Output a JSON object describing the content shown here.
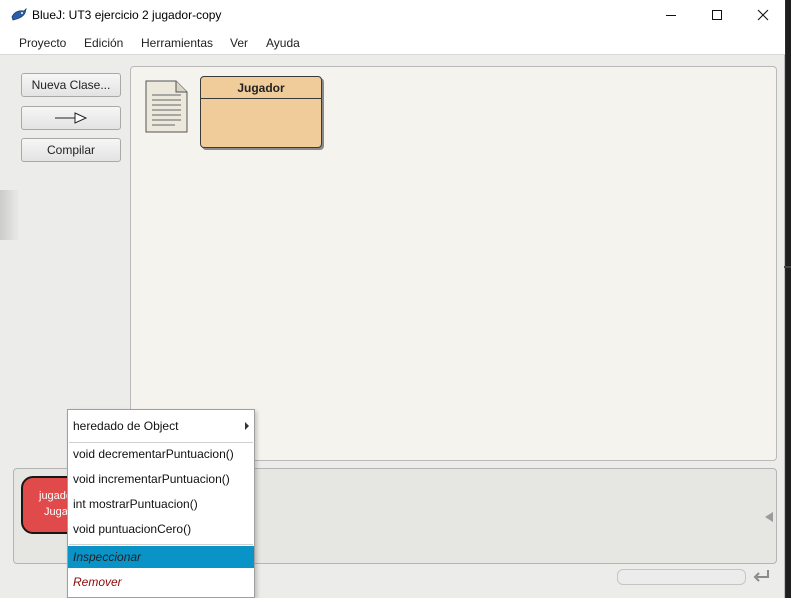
{
  "window": {
    "title": "BlueJ: UT3 ejercicio 2 jugador-copy",
    "controls": {
      "minimize_icon": "minimize-icon",
      "maximize_icon": "maximize-icon",
      "close_icon": "close-icon"
    }
  },
  "menubar": {
    "items": [
      "Proyecto",
      "Edición",
      "Herramientas",
      "Ver",
      "Ayuda"
    ]
  },
  "toolbar": {
    "new_class_label": "Nueva Clase...",
    "arrow_icon": "inheritance-arrow-icon",
    "compile_label": "Compilar"
  },
  "diagram": {
    "readme_icon": "readme-document-icon",
    "classes": [
      {
        "name": "Jugador",
        "color": "#f0cc9a"
      }
    ]
  },
  "object_bench": {
    "objects": [
      {
        "line1": "jugador1:",
        "line2": "Jugador",
        "color": "#e04a4a"
      }
    ]
  },
  "context_menu": {
    "items": [
      {
        "label": "heredado de Object",
        "submenu": true
      },
      {
        "label": "void decrementarPuntuacion()"
      },
      {
        "label": "void incrementarPuntuacion()"
      },
      {
        "label": "int mostrarPuntuacion()"
      },
      {
        "label": "void puntuacionCero()"
      },
      {
        "label": "Inspeccionar",
        "special": true,
        "selected": true
      },
      {
        "label": "Remover",
        "special": true
      }
    ]
  },
  "colors": {
    "selection": "#0a93c6",
    "object_fill": "#e04a4a",
    "class_fill": "#f0cc9a"
  }
}
